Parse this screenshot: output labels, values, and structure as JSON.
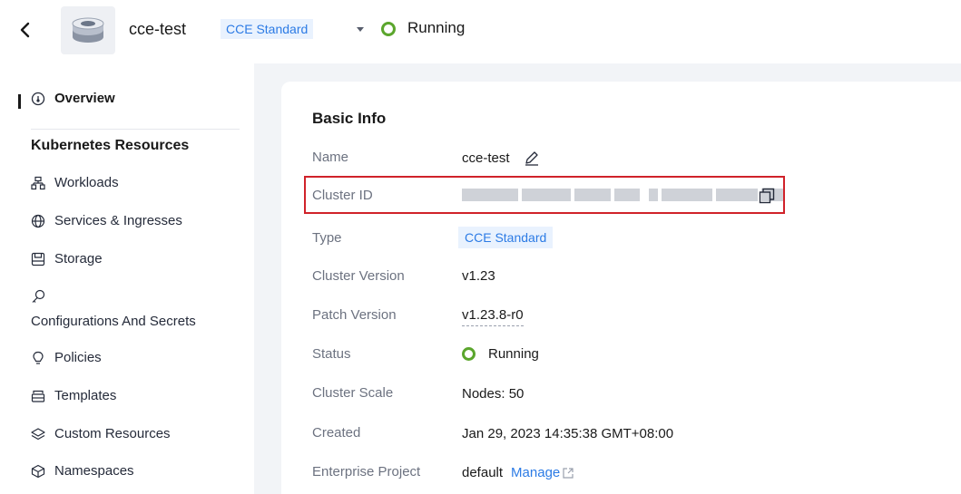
{
  "header": {
    "cluster_name": "cce-test",
    "cluster_tag": "CCE Standard",
    "status": "Running",
    "status_color": "#5ba62d",
    "back_icon": "chevron-left-icon",
    "cluster_icon": "cluster-stack-icon",
    "dropdown_icon": "caret-down-icon"
  },
  "sidebar": {
    "overview": "Overview",
    "section_title": "Kubernetes Resources",
    "items": [
      {
        "label": "Workloads",
        "icon": "workloads-icon"
      },
      {
        "label": "Services & Ingresses",
        "icon": "globe-icon"
      },
      {
        "label": "Storage",
        "icon": "storage-icon"
      },
      {
        "label": "Configurations And Secrets",
        "icon": "key-icon"
      },
      {
        "label": "Policies",
        "icon": "bulb-icon"
      },
      {
        "label": "Templates",
        "icon": "template-icon"
      },
      {
        "label": "Custom Resources",
        "icon": "layers-icon"
      },
      {
        "label": "Namespaces",
        "icon": "cube-icon"
      }
    ]
  },
  "basic_info": {
    "title": "Basic Info",
    "rows": {
      "name": {
        "label": "Name",
        "value": "cce-test"
      },
      "cluster_id": {
        "label": "Cluster ID"
      },
      "type": {
        "label": "Type",
        "value": "CCE Standard"
      },
      "version": {
        "label": "Cluster Version",
        "value": "v1.23"
      },
      "patch": {
        "label": "Patch Version",
        "value": "v1.23.8-r0"
      },
      "status": {
        "label": "Status",
        "value": "Running"
      },
      "scale": {
        "label": "Cluster Scale",
        "value": "Nodes: 50"
      },
      "created": {
        "label": "Created",
        "value": "Jan 29, 2023 14:35:38 GMT+08:00"
      },
      "project": {
        "label": "Enterprise Project",
        "value": "default",
        "link": "Manage"
      }
    }
  },
  "colors": {
    "accent": "#2c7be5",
    "highlight_border": "#d0222a",
    "content_bg": "#f2f4f7"
  }
}
